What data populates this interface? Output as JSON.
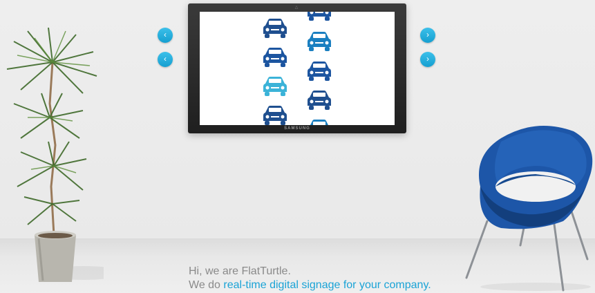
{
  "tv": {
    "brand": "SAMSUNG"
  },
  "nav": {
    "prev_icon": "chevron-left-icon",
    "next_icon": "chevron-right-icon",
    "prev_glyph": "‹",
    "next_glyph": "›"
  },
  "screen": {
    "icon": "car-icon",
    "car_colors": [
      "#1f4f8f",
      "#1a7fc0",
      "#3bb3d8",
      "#1c55a0"
    ]
  },
  "intro": {
    "line1": "Hi, we are FlatTurtle.",
    "line2_prefix": "We do ",
    "line2_link": "real-time digital signage for your company."
  },
  "colors": {
    "accent": "#1aa3d6",
    "text": "#8a8a8a"
  }
}
